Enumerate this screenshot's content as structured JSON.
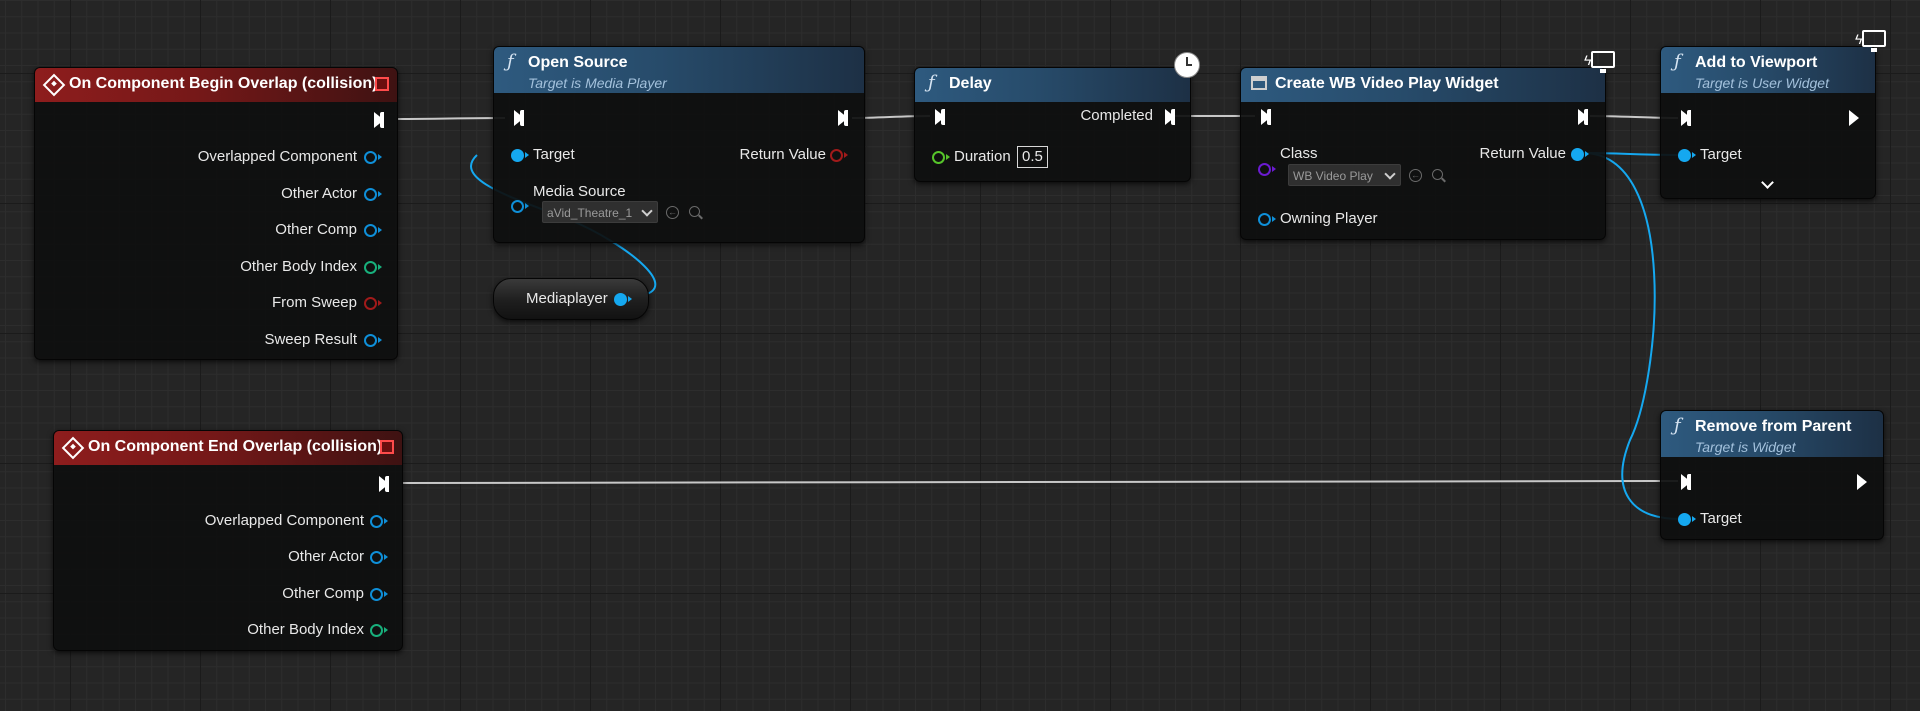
{
  "nodes": {
    "begin_overlap": {
      "title": "On Component Begin Overlap (collision)",
      "pins": [
        "Overlapped Component",
        "Other Actor",
        "Other Comp",
        "Other Body Index",
        "From Sweep",
        "Sweep Result"
      ]
    },
    "end_overlap": {
      "title": "On Component End Overlap (collision)",
      "pins": [
        "Overlapped Component",
        "Other Actor",
        "Other Comp",
        "Other Body Index"
      ]
    },
    "open_source": {
      "title": "Open Source",
      "subtitle": "Target is Media Player",
      "target_label": "Target",
      "return_label": "Return Value",
      "media_source_label": "Media Source",
      "media_source_value": "aVid_Theatre_1"
    },
    "mediaplayer": {
      "label": "Mediaplayer"
    },
    "delay": {
      "title": "Delay",
      "completed_label": "Completed",
      "duration_label": "Duration",
      "duration_value": "0.5"
    },
    "create_widget": {
      "title": "Create WB Video Play Widget",
      "class_label": "Class",
      "class_value": "WB Video Play",
      "return_label": "Return Value",
      "owning_player_label": "Owning Player"
    },
    "add_to_viewport": {
      "title": "Add to Viewport",
      "subtitle": "Target is User Widget",
      "target_label": "Target"
    },
    "remove_from_parent": {
      "title": "Remove from Parent",
      "subtitle": "Target is Widget",
      "target_label": "Target"
    }
  },
  "icons": {
    "function": "ƒ",
    "event": "event-diamond-icon",
    "latent": "clock-icon",
    "client_only": "monitor-icon"
  },
  "colors": {
    "event_header": "#8e1d1d",
    "function_header": "#2e5a7f",
    "object_pin": "#15a8f0",
    "integer_pin": "#18b07c",
    "bool_pin": "#a11a1a",
    "float_pin": "#56c42a",
    "class_pin": "#6b1bd1",
    "exec_wire": "#cfcfcf"
  }
}
